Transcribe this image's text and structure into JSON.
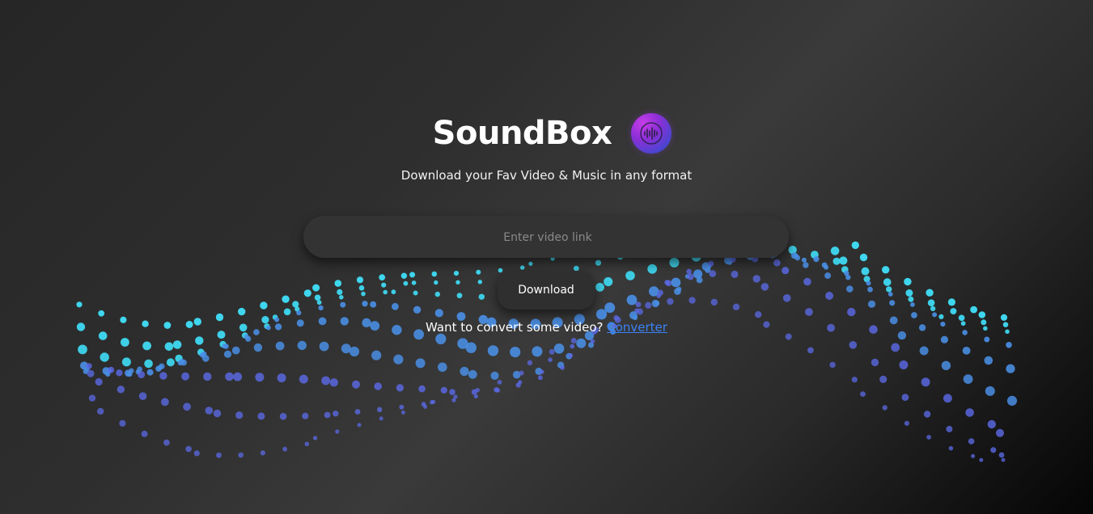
{
  "app": {
    "title": "SoundBox",
    "tagline": "Download your Fav Video & Music in any format",
    "logo_icon": "soundwave-icon",
    "logo_colors": [
      "#c73ce8",
      "#3a4ad0"
    ]
  },
  "form": {
    "link_placeholder": "Enter video link",
    "link_value": "",
    "download_label": "Download"
  },
  "convert": {
    "prompt": "Want to convert some video?",
    "link_label": "Converter"
  },
  "background": {
    "decoration": "particle-wave",
    "particle_colors": [
      "#3fd6ee",
      "#4a8fe6",
      "#5b6ae6"
    ]
  }
}
